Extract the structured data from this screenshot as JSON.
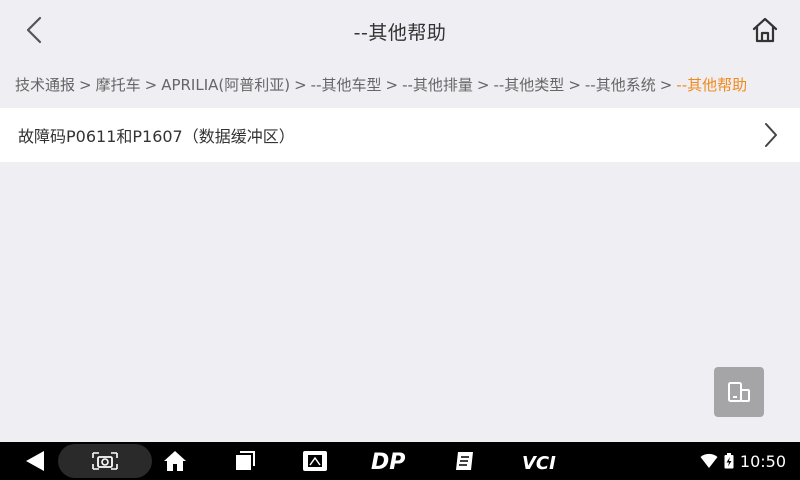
{
  "header": {
    "title": "--其他帮助"
  },
  "breadcrumb": [
    "技术通报",
    "摩托车",
    "APRILIA(阿普利亚)",
    "--其他车型",
    "--其他排量",
    "--其他类型",
    "--其他系统"
  ],
  "breadcrumb_current": "--其他帮助",
  "breadcrumb_separator": ">",
  "list": {
    "items": [
      {
        "label": "故障码P0611和P1607（数据缓冲区）"
      }
    ]
  },
  "statusbar": {
    "time": "10:50"
  },
  "navbar": {
    "dp_label": "DP",
    "vci_label": "VCI"
  },
  "colors": {
    "accent": "#f08a1c",
    "background": "#efeef3"
  }
}
